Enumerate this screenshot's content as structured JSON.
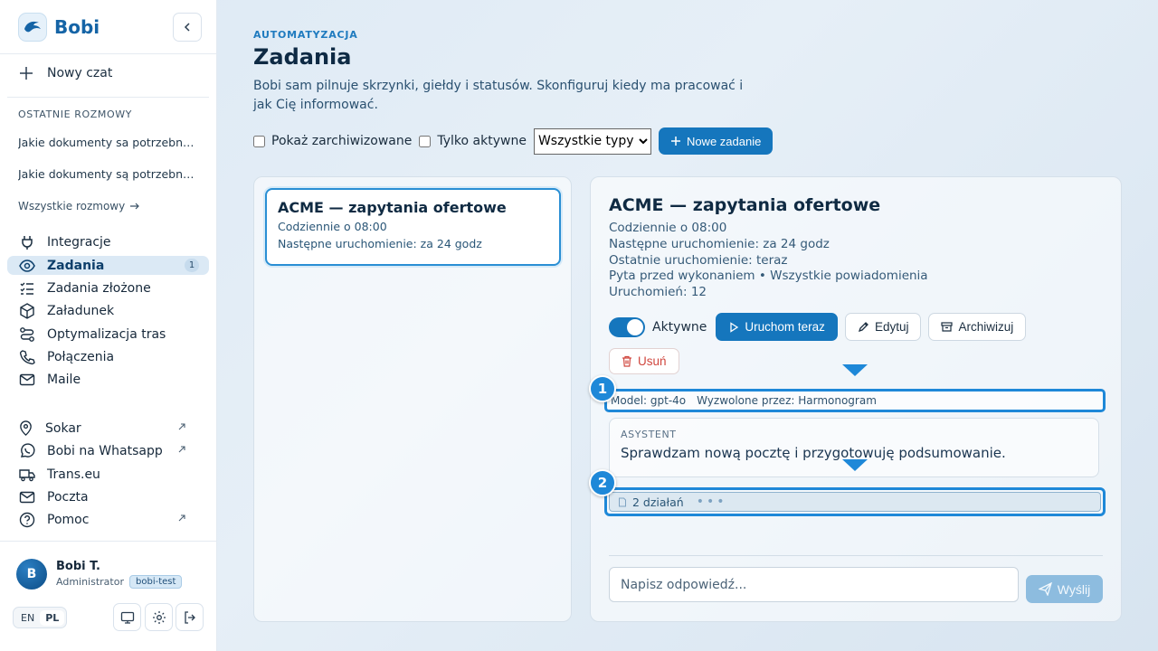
{
  "brand": {
    "name": "Bobi"
  },
  "sidebar": {
    "new_chat": "Nowy czat",
    "recent_label": "OSTATNIE ROZMOWY",
    "recent": [
      "Jakie dokumenty sa potrzebne do...",
      "Jakie dokumenty są potrzebne do..."
    ],
    "all_chats": "Wszystkie rozmowy",
    "nav": [
      {
        "label": "Integracje",
        "icon": "plug-icon"
      },
      {
        "label": "Zadania",
        "icon": "eye-icon",
        "badge": "1",
        "active": true
      },
      {
        "label": "Zadania złożone",
        "icon": "checklist-icon"
      },
      {
        "label": "Załadunek",
        "icon": "box-icon"
      },
      {
        "label": "Optymalizacja tras",
        "icon": "route-icon"
      },
      {
        "label": "Połączenia",
        "icon": "phone-icon"
      },
      {
        "label": "Maile",
        "icon": "mail-icon"
      }
    ],
    "external": [
      {
        "label": "Sokar",
        "icon": "location-icon",
        "external": true
      },
      {
        "label": "Bobi na Whatsapp",
        "icon": "whatsapp-icon",
        "external": true
      },
      {
        "label": "Trans.eu",
        "icon": "truck-icon",
        "external": false
      },
      {
        "label": "Poczta",
        "icon": "mail-icon",
        "external": false
      },
      {
        "label": "Pomoc",
        "icon": "help-icon",
        "external": true
      }
    ]
  },
  "profile": {
    "initial": "B",
    "name": "Bobi T.",
    "role": "Administrator",
    "env": "bobi-test"
  },
  "lang": {
    "en": "EN",
    "pl": "PL",
    "active": "PL"
  },
  "header": {
    "eyebrow": "AUTOMATYZACJA",
    "title": "Zadania",
    "description": "Bobi sam pilnuje skrzynki, giełdy i statusów. Skonfiguruj kiedy ma pracować i jak Cię informować."
  },
  "filters": {
    "show_archived": "Pokaż zarchiwizowane",
    "only_active": "Tylko aktywne",
    "type_select": "Wszystkie typy",
    "new_task": "Nowe zadanie"
  },
  "task_list": [
    {
      "title": "ACME — zapytania ofertowe",
      "schedule": "Codziennie o 08:00",
      "next_run": "Następne uruchomienie: za 24 godz"
    }
  ],
  "detail": {
    "title": "ACME — zapytania ofertowe",
    "schedule": "Codziennie o 08:00",
    "next_run": "Następne uruchomienie: za 24 godz",
    "last_run": "Ostatnie uruchomienie: teraz",
    "settings": "Pyta przed wykonaniem  •  Wszystkie powiadomienia",
    "runs": "Uruchomień: 12",
    "active_label": "Aktywne",
    "run_now": "Uruchom teraz",
    "edit": "Edytuj",
    "archive": "Archiwizuj",
    "delete": "Usuń",
    "meta_model": "Model: gpt-4o",
    "meta_trigger": "Wyzwolone przez: Harmonogram",
    "assistant_role": "ASYSTENT",
    "assistant_text": "Sprawdzam nową pocztę i przygotowuję podsumowanie.",
    "actions_summary": "2 działań",
    "reply_placeholder": "Napisz odpowiedź...",
    "send": "Wyślij"
  },
  "markers": [
    "1",
    "2"
  ],
  "colors": {
    "accent": "#1576bd",
    "highlight": "#1e88d8",
    "danger": "#d0463e"
  }
}
